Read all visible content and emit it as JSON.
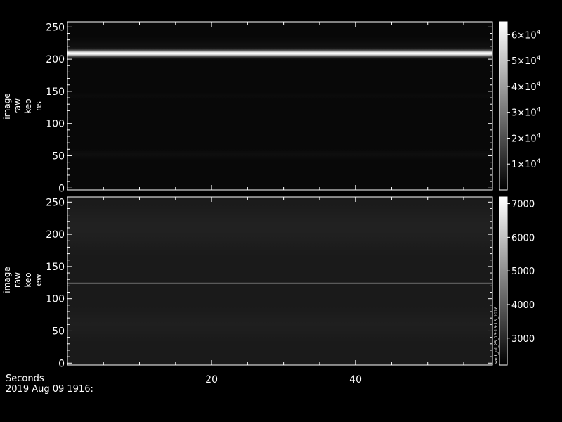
{
  "footer": {
    "xlabel": "Seconds",
    "date": "2019 Aug 09 1916:"
  },
  "colors": {
    "background": "#000000",
    "axes": "#ffffff",
    "colormap": "grayscale"
  },
  "chart_data": [
    {
      "type": "heatmap",
      "title": "",
      "ylabel_lines": [
        "image",
        "raw",
        "keo",
        "ns"
      ],
      "xlim": [
        0,
        59
      ],
      "ylim": [
        -3,
        258
      ],
      "yticks": [
        0,
        50,
        100,
        150,
        200,
        250
      ],
      "xticks": [
        20,
        40
      ],
      "xtick_labels_shown": false,
      "background_level": 0.03,
      "bright_band": {
        "center": 209,
        "halfwidth": 7,
        "peak": 1.0
      },
      "faint_bands": [
        {
          "center": 220,
          "halfwidth": 10,
          "level": 0.06
        },
        {
          "center": 143,
          "halfwidth": 4,
          "level": 0.045
        },
        {
          "center": 52,
          "halfwidth": 6,
          "level": 0.055
        }
      ],
      "colorbar": {
        "range": [
          0,
          65000
        ],
        "tick_values": [
          10000,
          20000,
          30000,
          40000,
          50000,
          60000
        ],
        "tick_labels": [
          {
            "mant": "1×10",
            "exp": "4"
          },
          {
            "mant": "2×10",
            "exp": "4"
          },
          {
            "mant": "3×10",
            "exp": "4"
          },
          {
            "mant": "4×10",
            "exp": "4"
          },
          {
            "mant": "5×10",
            "exp": "4"
          },
          {
            "mant": "6×10",
            "exp": "4"
          }
        ]
      }
    },
    {
      "type": "heatmap",
      "title": "",
      "ylabel_lines": [
        "image",
        "raw",
        "keo",
        "ew"
      ],
      "xlim": [
        0,
        59
      ],
      "ylim": [
        -3,
        258
      ],
      "yticks": [
        0,
        50,
        100,
        150,
        200,
        250
      ],
      "xticks": [
        20,
        40
      ],
      "xtick_labels_shown": true,
      "xtick_labels": [
        "20",
        "40"
      ],
      "background_level": 0.1,
      "bright_band": {
        "center": 124,
        "halfwidth": 1.2,
        "peak": 0.85
      },
      "faint_bands": [
        {
          "center": 210,
          "halfwidth": 30,
          "level": 0.13
        },
        {
          "center": 60,
          "halfwidth": 20,
          "level": 0.12
        },
        {
          "center": 5,
          "halfwidth": 8,
          "level": 0.06
        }
      ],
      "colorbar": {
        "range": [
          2200,
          7200
        ],
        "tick_values": [
          3000,
          4000,
          5000,
          6000,
          7000
        ],
        "tick_labels": [
          {
            "mant": "3000",
            "exp": ""
          },
          {
            "mant": "4000",
            "exp": ""
          },
          {
            "mant": "5000",
            "exp": ""
          },
          {
            "mant": "6000",
            "exp": ""
          },
          {
            "mant": "7000",
            "exp": ""
          }
        ]
      },
      "side_text": "wed_Jul_25_13:18:15_2018"
    }
  ]
}
